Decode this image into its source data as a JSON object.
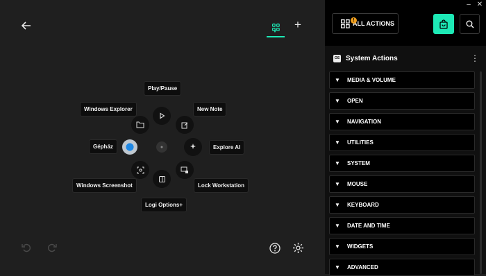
{
  "window": {
    "minimize": "–",
    "close": "✕"
  },
  "editor": {
    "labels": {
      "play_pause": "Play/Pause",
      "windows_explorer": "Windows Explorer",
      "new_note": "New Note",
      "gephaz": "Gépház",
      "explore_ai": "Explore AI",
      "windows_screenshot": "Windows Screenshot",
      "lock_workstation": "Lock Workstation",
      "logi_options": "Logi Options+"
    }
  },
  "panel": {
    "all_actions_label": "ALL ACTIONS",
    "badge": "!",
    "section_title": "System Actions",
    "os_icon_text": "OS",
    "categories": [
      "MEDIA & VOLUME",
      "OPEN",
      "NAVIGATION",
      "UTILITIES",
      "SYSTEM",
      "MOUSE",
      "KEYBOARD",
      "DATE AND TIME",
      "WIDGETS",
      "ADVANCED"
    ]
  },
  "colors": {
    "accent": "#1de9b6",
    "badge": "#f0a020",
    "background": "#1f1f1f",
    "panel": "#101010"
  }
}
